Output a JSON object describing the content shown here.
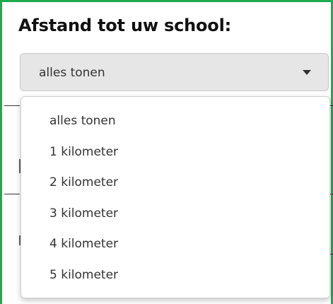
{
  "filter": {
    "title": "Afstand tot uw school:",
    "selected": "alles tonen",
    "options": [
      "alles tonen",
      "1 kilometer",
      "2 kilometer",
      "3 kilometer",
      "4 kilometer",
      "5 kilometer"
    ],
    "caret_icon": "caret-down-icon"
  },
  "colors": {
    "frame_border": "#1eaa4f",
    "select_bg": "#e6e6e6",
    "menu_bg": "#ffffff",
    "text": "#333333"
  }
}
